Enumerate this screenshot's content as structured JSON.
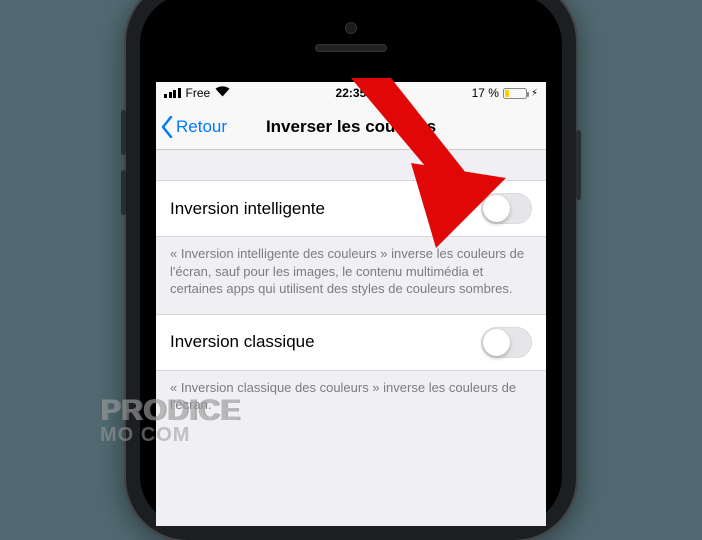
{
  "status": {
    "carrier": "Free",
    "time": "22:35",
    "battery_pct": "17 %",
    "bolt": "⚡︎",
    "wifi_glyph": "▾"
  },
  "nav": {
    "back_label": "Retour",
    "title": "Inverser les couleurs"
  },
  "rows": {
    "smart": {
      "label": "Inversion intelligente",
      "footer": "« Inversion intelligente des couleurs » inverse les couleurs de l'écran, sauf pour les images, le contenu multimédia et certaines apps qui utilisent des styles de couleurs sombres."
    },
    "classic": {
      "label": "Inversion classique",
      "footer": "« Inversion classique des couleurs » inverse les couleurs de l'écran."
    }
  },
  "watermark": {
    "line1": "PRODICE",
    "line2": "MO        COM"
  }
}
